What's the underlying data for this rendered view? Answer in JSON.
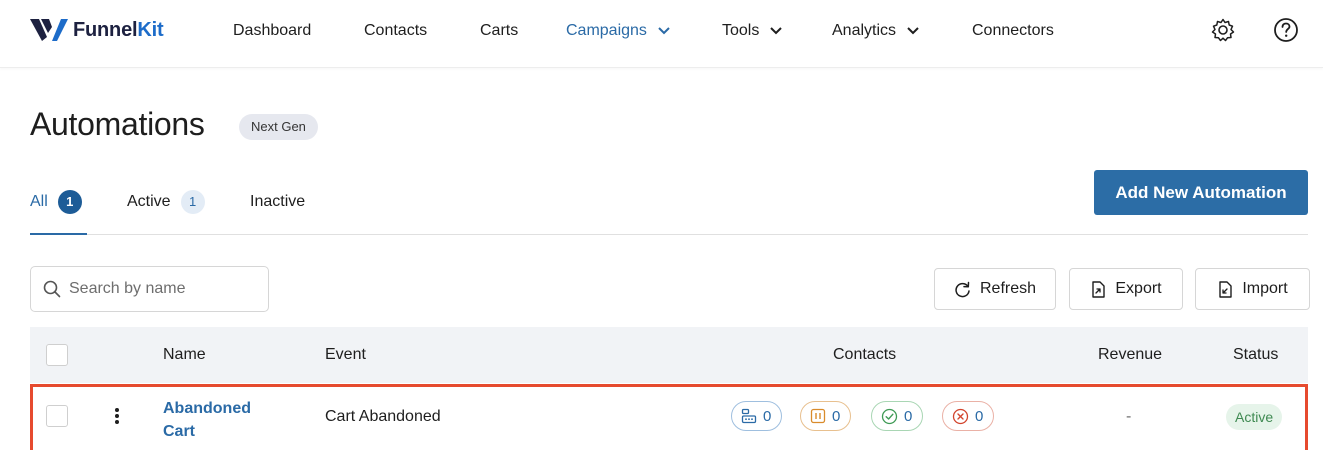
{
  "brand": {
    "name_part1": "Funnel",
    "name_part2": "Kit"
  },
  "nav": {
    "items": [
      {
        "label": "Dashboard"
      },
      {
        "label": "Contacts"
      },
      {
        "label": "Carts"
      },
      {
        "label": "Campaigns"
      },
      {
        "label": "Tools"
      },
      {
        "label": "Analytics"
      },
      {
        "label": "Connectors"
      }
    ],
    "active": "Campaigns"
  },
  "header": {
    "title": "Automations",
    "badge": "Next Gen"
  },
  "tabs": [
    {
      "label": "All",
      "count": "1"
    },
    {
      "label": "Active",
      "count": "1"
    },
    {
      "label": "Inactive"
    }
  ],
  "add_button": "Add New Automation",
  "search": {
    "placeholder": "Search by name"
  },
  "actions": {
    "refresh": "Refresh",
    "export": "Export",
    "import": "Import"
  },
  "table": {
    "columns": [
      "Name",
      "Event",
      "Contacts",
      "Revenue",
      "Status"
    ],
    "rows": [
      {
        "name": "Abandoned Cart",
        "event": "Cart Abandoned",
        "contacts": {
          "active": "0",
          "paused": "0",
          "completed": "0",
          "failed": "0"
        },
        "revenue": "-",
        "status": "Active"
      }
    ]
  },
  "colors": {
    "accent": "#2a6aa6",
    "primary_button": "#2c6da6",
    "highlight_border": "#e64a2e",
    "status_active_bg": "#e6f4ea",
    "status_active_text": "#3f8a52",
    "pill_blue": "#2a6aa6",
    "pill_orange": "#d98b2b",
    "pill_green": "#3f9a55",
    "pill_red": "#d2452e"
  },
  "icons": [
    "funnelkit-logo",
    "chevron-down-icon",
    "settings-icon",
    "help-icon",
    "search-icon",
    "refresh-icon",
    "export-icon",
    "import-icon",
    "more-vertical-icon",
    "queue-icon",
    "pause-icon",
    "check-circle-icon",
    "x-circle-icon"
  ]
}
